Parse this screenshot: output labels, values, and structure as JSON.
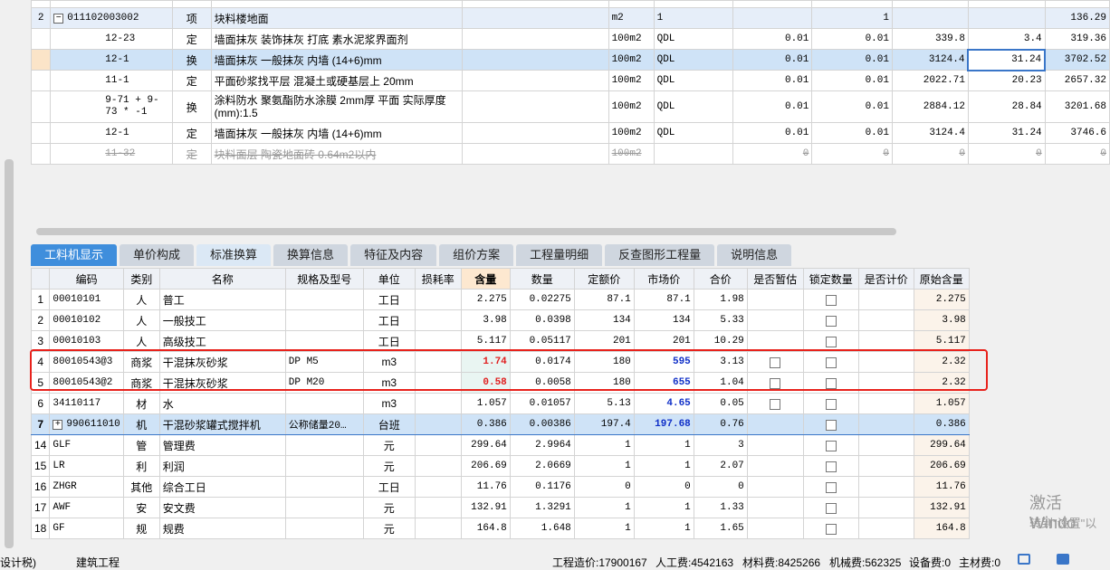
{
  "top_rows": [
    {
      "idx": "2",
      "expander": "−",
      "code": "011102003002",
      "cat": "项",
      "name": "块料楼地面",
      "unit": "m2",
      "qty_expr": "1",
      "content": "",
      "qty": "1",
      "price": "",
      "sum": "",
      "total": "136.29"
    },
    {
      "idx": "",
      "code": "12-23",
      "cat": "定",
      "name": "墙面抹灰 装饰抹灰 打底 素水泥浆界面剂",
      "unit": "100m2",
      "qty_expr": "QDL",
      "content": "0.01",
      "qty": "0.01",
      "price": "339.8",
      "sum": "3.4",
      "total": "319.36"
    },
    {
      "idx": "",
      "code": "12-1",
      "cat": "换",
      "name": "墙面抹灰 一般抹灰 内墙 (14+6)mm",
      "unit": "100m2",
      "qty_expr": "QDL",
      "content": "0.01",
      "qty": "0.01",
      "price": "3124.4",
      "sum": "31.24",
      "total": "3702.52"
    },
    {
      "idx": "",
      "code": "11-1",
      "cat": "定",
      "name": "平面砂浆找平层 混凝土或硬基层上 20mm",
      "unit": "100m2",
      "qty_expr": "QDL",
      "content": "0.01",
      "qty": "0.01",
      "price": "2022.71",
      "sum": "20.23",
      "total": "2657.32"
    },
    {
      "idx": "",
      "code": "9-71 + 9-73 * -1",
      "cat": "换",
      "name": "涂料防水 聚氨酯防水涂膜 2mm厚 平面  实际厚度(mm):1.5",
      "unit": "100m2",
      "qty_expr": "QDL",
      "content": "0.01",
      "qty": "0.01",
      "price": "2884.12",
      "sum": "28.84",
      "total": "3201.68"
    },
    {
      "idx": "",
      "code": "12-1",
      "cat": "定",
      "name": "墙面抹灰 一般抹灰 内墙 (14+6)mm",
      "unit": "100m2",
      "qty_expr": "QDL",
      "content": "0.01",
      "qty": "0.01",
      "price": "3124.4",
      "sum": "31.24",
      "total": "3746.6"
    },
    {
      "idx": "",
      "code": "11-32",
      "cat": "定",
      "name": "块料面层 陶瓷地面砖 0.64m2以内",
      "unit": "100m2",
      "qty_expr": "",
      "content": "0",
      "qty": "0",
      "price": "0",
      "sum": "0",
      "total": "0"
    }
  ],
  "tabs": [
    "工料机显示",
    "单价构成",
    "标准换算",
    "换算信息",
    "特征及内容",
    "组价方案",
    "工程量明细",
    "反查图形工程量",
    "说明信息"
  ],
  "headers": [
    "编码",
    "类别",
    "名称",
    "规格及型号",
    "单位",
    "损耗率",
    "含量",
    "数量",
    "定额价",
    "市场价",
    "合价",
    "是否暂估",
    "锁定数量",
    "是否计价",
    "原始含量"
  ],
  "rows": [
    {
      "rn": "1",
      "code": "00010101",
      "cat": "人",
      "name": "普工",
      "spec": "",
      "unit": "工日",
      "loss": "",
      "content": "2.275",
      "qty": "0.02275",
      "quota": "87.1",
      "market": "87.1",
      "sum": "1.98",
      "est": false,
      "lock": true,
      "orig": "2.275"
    },
    {
      "rn": "2",
      "code": "00010102",
      "cat": "人",
      "name": "一般技工",
      "spec": "",
      "unit": "工日",
      "loss": "",
      "content": "3.98",
      "qty": "0.0398",
      "quota": "134",
      "market": "134",
      "sum": "5.33",
      "est": false,
      "lock": true,
      "orig": "3.98"
    },
    {
      "rn": "3",
      "code": "00010103",
      "cat": "人",
      "name": "高级技工",
      "spec": "",
      "unit": "工日",
      "loss": "",
      "content": "5.117",
      "qty": "0.05117",
      "quota": "201",
      "market": "201",
      "sum": "10.29",
      "est": false,
      "lock": true,
      "orig": "5.117"
    },
    {
      "rn": "4",
      "code": "80010543@3",
      "cat": "商浆",
      "name": "干混抹灰砂浆",
      "spec": "DP M5",
      "unit": "m3",
      "loss": "",
      "content": "1.74",
      "qty": "0.0174",
      "quota": "180",
      "market": "595",
      "sum": "3.13",
      "est": true,
      "lock": true,
      "orig": "2.32"
    },
    {
      "rn": "5",
      "code": "80010543@2",
      "cat": "商浆",
      "name": "干混抹灰砂浆",
      "spec": "DP M20",
      "unit": "m3",
      "loss": "",
      "content": "0.58",
      "qty": "0.0058",
      "quota": "180",
      "market": "655",
      "sum": "1.04",
      "est": true,
      "lock": true,
      "orig": "2.32"
    },
    {
      "rn": "6",
      "code": "34110117",
      "cat": "材",
      "name": "水",
      "spec": "",
      "unit": "m3",
      "loss": "",
      "content": "1.057",
      "qty": "0.01057",
      "quota": "5.13",
      "market": "4.65",
      "sum": "0.05",
      "est": true,
      "lock": true,
      "orig": "1.057"
    },
    {
      "rn": "7",
      "code": "990611010",
      "cat": "机",
      "name": "干混砂浆罐式搅拌机",
      "spec": "公称储量20…",
      "unit": "台班",
      "loss": "",
      "content": "0.386",
      "qty": "0.00386",
      "quota": "197.4",
      "market": "197.68",
      "sum": "0.76",
      "est": false,
      "lock": true,
      "orig": "0.386"
    },
    {
      "rn": "14",
      "code": "GLF",
      "cat": "管",
      "name": "管理费",
      "spec": "",
      "unit": "元",
      "loss": "",
      "content": "299.64",
      "qty": "2.9964",
      "quota": "1",
      "market": "1",
      "sum": "3",
      "est": false,
      "lock": true,
      "orig": "299.64"
    },
    {
      "rn": "15",
      "code": "LR",
      "cat": "利",
      "name": "利润",
      "spec": "",
      "unit": "元",
      "loss": "",
      "content": "206.69",
      "qty": "2.0669",
      "quota": "1",
      "market": "1",
      "sum": "2.07",
      "est": false,
      "lock": true,
      "orig": "206.69"
    },
    {
      "rn": "16",
      "code": "ZHGR",
      "cat": "其他",
      "name": "综合工日",
      "spec": "",
      "unit": "工日",
      "loss": "",
      "content": "11.76",
      "qty": "0.1176",
      "quota": "0",
      "market": "0",
      "sum": "0",
      "est": false,
      "lock": true,
      "orig": "11.76"
    },
    {
      "rn": "17",
      "code": "AWF",
      "cat": "安",
      "name": "安文费",
      "spec": "",
      "unit": "元",
      "loss": "",
      "content": "132.91",
      "qty": "1.3291",
      "quota": "1",
      "market": "1",
      "sum": "1.33",
      "est": false,
      "lock": true,
      "orig": "132.91"
    },
    {
      "rn": "18",
      "code": "GF",
      "cat": "规",
      "name": "规费",
      "spec": "",
      "unit": "元",
      "loss": "",
      "content": "164.8",
      "qty": "1.648",
      "quota": "1",
      "market": "1",
      "sum": "1.65",
      "est": false,
      "lock": true,
      "orig": "164.8"
    }
  ],
  "status": {
    "left": "设计税)",
    "project": "建筑工程",
    "cost": "工程造价:17900167",
    "labor": "人工费:4542163",
    "material": "材料费:8425266",
    "machine": "机械费:562325",
    "equipment": "设备费:0",
    "main_material": "主材费:0"
  },
  "watermark": {
    "line1": "激活 Windo",
    "line2": "转到\"设置\"以"
  }
}
